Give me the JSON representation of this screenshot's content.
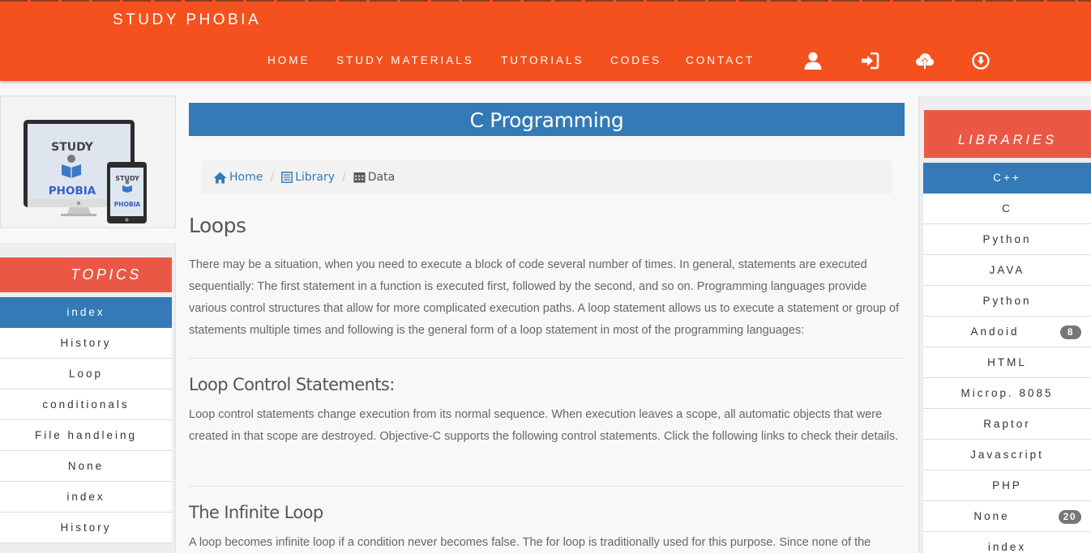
{
  "brand": "STUDY PHOBIA",
  "nav": {
    "items": [
      "HOME",
      "STUDY MATERIALS",
      "TUTORIALS",
      "CODES",
      "CONTACT"
    ],
    "icons": [
      "user-icon",
      "login-icon",
      "upload-icon",
      "download-icon"
    ]
  },
  "logo": {
    "line1": "STUDY",
    "line2": "PHOBIA"
  },
  "topics": {
    "heading": "TOPICS",
    "items": [
      "index",
      "History",
      "Loop",
      "conditionals",
      "File handleing",
      "None",
      "index",
      "History"
    ],
    "active": 0
  },
  "main": {
    "title": "C Programming",
    "breadcrumb": {
      "home": "Home",
      "library": "Library",
      "current": "Data"
    },
    "sections": [
      {
        "heading": "Loops",
        "text": "There may be a situation, when you need to execute a block of code several number of times. In general, statements are executed sequentially: The first statement in a function is executed first, followed by the second, and so on. Programming languages provide various control structures that allow for more complicated execution paths. A loop statement allows us to execute a statement or group of statements multiple times and following is the general form of a loop statement in most of the programming languages:"
      },
      {
        "heading": "Loop Control Statements:",
        "text": "Loop control statements change execution from its normal sequence. When execution leaves a scope, all automatic objects that were created in that scope are destroyed. Objective-C supports the following control statements. Click the following links to check their details."
      },
      {
        "heading": "The Infinite Loop",
        "text": "A loop becomes infinite loop if a condition never becomes false. The for loop is traditionally used for this purpose. Since none of the"
      }
    ]
  },
  "libraries": {
    "heading": "LIBRARIES",
    "items": [
      {
        "label": "C++",
        "badge": ""
      },
      {
        "label": "C",
        "badge": ""
      },
      {
        "label": "Python",
        "badge": ""
      },
      {
        "label": "JAVA",
        "badge": ""
      },
      {
        "label": "Python",
        "badge": ""
      },
      {
        "label": "Andoid",
        "badge": "8"
      },
      {
        "label": "HTML",
        "badge": ""
      },
      {
        "label": "Microp. 8085",
        "badge": ""
      },
      {
        "label": "Raptor",
        "badge": ""
      },
      {
        "label": "Javascript",
        "badge": ""
      },
      {
        "label": "PHP",
        "badge": ""
      },
      {
        "label": "None",
        "badge": "20"
      },
      {
        "label": "index",
        "badge": ""
      }
    ],
    "active": 0
  },
  "colors": {
    "header": "#f4511e",
    "accent": "#ea5845",
    "primary": "#337ab7"
  }
}
